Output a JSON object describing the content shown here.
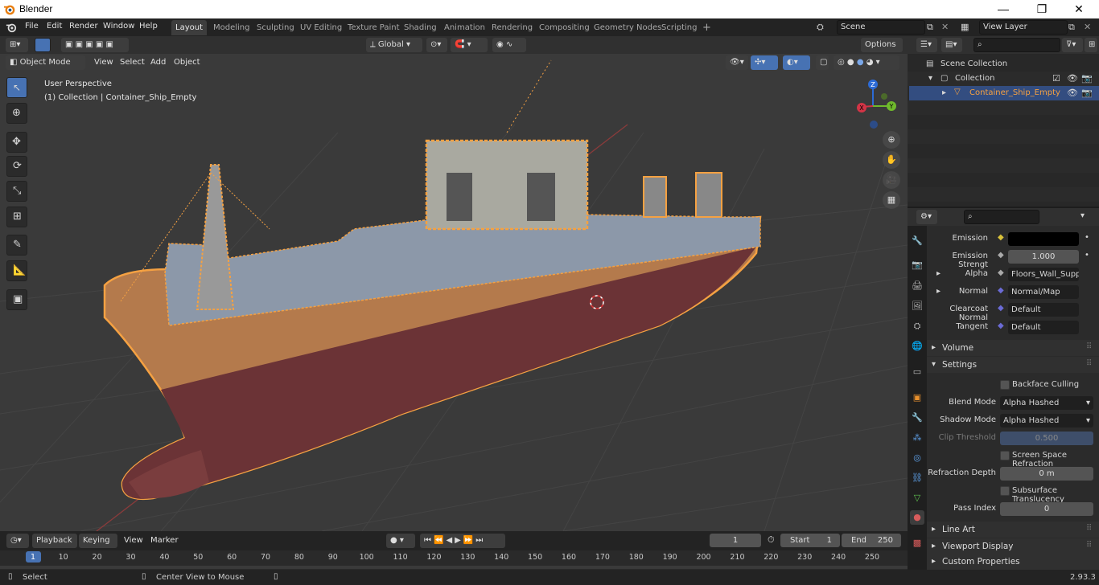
{
  "window": {
    "title": "Blender",
    "minimize": "—",
    "maximize": "❐",
    "close": "✕"
  },
  "menus": [
    "File",
    "Edit",
    "Render",
    "Window",
    "Help"
  ],
  "workspaces": [
    {
      "label": "Layout",
      "active": true
    },
    {
      "label": "Modeling",
      "active": false
    },
    {
      "label": "Sculpting",
      "active": false
    },
    {
      "label": "UV Editing",
      "active": false
    },
    {
      "label": "Texture Paint",
      "active": false
    },
    {
      "label": "Shading",
      "active": false
    },
    {
      "label": "Animation",
      "active": false
    },
    {
      "label": "Rendering",
      "active": false
    },
    {
      "label": "Compositing",
      "active": false
    },
    {
      "label": "Geometry Nodes",
      "active": false
    },
    {
      "label": "Scripting",
      "active": false
    }
  ],
  "scene": {
    "name": "Scene"
  },
  "view_layer": {
    "name": "View Layer"
  },
  "viewport": {
    "transform_orientation": "Global",
    "options_label": "Options",
    "mode": "Object Mode",
    "menus": [
      "View",
      "Select",
      "Add",
      "Object"
    ],
    "overlay_perspective": "User Perspective",
    "overlay_collection": "(1) Collection | Container_Ship_Empty",
    "gizmo": {
      "z": "Z",
      "y": "Y",
      "x": "X"
    }
  },
  "outliner": {
    "root": "Scene Collection",
    "collection": "Collection",
    "object": "Container_Ship_Empty"
  },
  "properties": {
    "rows": [
      {
        "label": "Emission",
        "value": ""
      },
      {
        "label": "Emission Strengt",
        "value": "1.000"
      },
      {
        "label": "Alpha",
        "value": "Floors_Wall_Support..."
      },
      {
        "label": "Normal",
        "value": "Normal/Map"
      },
      {
        "label": "Clearcoat Normal",
        "value": "Default"
      },
      {
        "label": "Tangent",
        "value": "Default"
      }
    ],
    "volume_header": "Volume",
    "settings_header": "Settings",
    "backface_culling": "Backface Culling",
    "blend_mode_label": "Blend Mode",
    "blend_mode": "Alpha Hashed",
    "shadow_mode_label": "Shadow Mode",
    "shadow_mode": "Alpha Hashed",
    "clip_threshold_label": "Clip Threshold",
    "clip_threshold": "0.500",
    "screen_space_refraction": "Screen Space Refraction",
    "refraction_depth_label": "Refraction Depth",
    "refraction_depth": "0 m",
    "subsurface_translucency": "Subsurface Translucency",
    "pass_index_label": "Pass Index",
    "pass_index": "0",
    "line_art": "Line Art",
    "viewport_display": "Viewport Display",
    "custom_properties": "Custom Properties"
  },
  "timeline": {
    "menus": [
      "Playback",
      "Keying",
      "View",
      "Marker"
    ],
    "current_frame": "1",
    "start_label": "Start",
    "start": "1",
    "end_label": "End",
    "end": "250",
    "ticks": [
      "1",
      "10",
      "20",
      "30",
      "40",
      "50",
      "60",
      "70",
      "80",
      "90",
      "100",
      "110",
      "120",
      "130",
      "140",
      "150",
      "160",
      "170",
      "180",
      "190",
      "200",
      "210",
      "220",
      "230",
      "240",
      "250"
    ]
  },
  "status": {
    "left": "Select",
    "middle": "Center View to Mouse",
    "version": "2.93.3"
  },
  "colors": {
    "accent": "#4772b3",
    "selection_outline": "#f5a142",
    "header": "#303030",
    "panel": "#2b2b2b"
  }
}
